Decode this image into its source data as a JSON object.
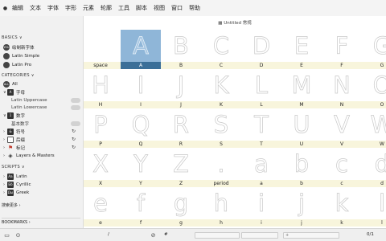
{
  "menubar": {
    "items": [
      "编辑",
      "文本",
      "字体",
      "字形",
      "元素",
      "轮廓",
      "工具",
      "脚本",
      "视图",
      "窗口",
      "帮助"
    ]
  },
  "sidebar": {
    "basics_header": "BASICS",
    "fonts": [
      {
        "badge": "YOU",
        "label": "绘制新字体"
      },
      {
        "badge": "",
        "label": "Latin Simple"
      },
      {
        "badge": "",
        "label": "Latin Pro"
      }
    ],
    "categories_header": "CATEGORIES",
    "all": {
      "badge": "ALL",
      "label": "All"
    },
    "letter": {
      "label": "字母"
    },
    "latin_upper": "Latin Uppercase",
    "latin_lower": "Latin Lowercase",
    "number": {
      "label": "数字"
    },
    "basic_number": "基本数字",
    "symbols": {
      "label": "符号"
    },
    "suffix": {
      "label": "后缀"
    },
    "mark": {
      "label": "标记"
    },
    "layers": {
      "label": "Layers & Masters"
    },
    "scripts_header": "SCRIPTS",
    "scripts": [
      {
        "badge": "Aa",
        "label": "Latin"
      },
      {
        "badge": "Бб",
        "label": "Cyrillic"
      },
      {
        "badge": "Ωω",
        "label": "Greek"
      }
    ],
    "search_more": "搜索更多",
    "bookmarks": "BOOKMARKS"
  },
  "document": {
    "title": "Untitled 常规"
  },
  "grid": {
    "rows": [
      [
        {
          "g": "A",
          "l": "space",
          "sel": false,
          "hide": true
        },
        {
          "g": "A",
          "l": "A",
          "sel": true
        },
        {
          "g": "B",
          "l": "B"
        },
        {
          "g": "C",
          "l": "C"
        },
        {
          "g": "D",
          "l": "D"
        },
        {
          "g": "E",
          "l": "E"
        },
        {
          "g": "F",
          "l": "F"
        },
        {
          "g": "G",
          "l": "G"
        }
      ],
      [
        {
          "g": "H",
          "l": "H"
        },
        {
          "g": "I",
          "l": "I"
        },
        {
          "g": "J",
          "l": "J"
        },
        {
          "g": "K",
          "l": "K"
        },
        {
          "g": "L",
          "l": "L"
        },
        {
          "g": "M",
          "l": "M"
        },
        {
          "g": "N",
          "l": "N"
        },
        {
          "g": "O",
          "l": "O"
        }
      ],
      [
        {
          "g": "P",
          "l": "P"
        },
        {
          "g": "Q",
          "l": "Q"
        },
        {
          "g": "R",
          "l": "R"
        },
        {
          "g": "S",
          "l": "S"
        },
        {
          "g": "T",
          "l": "T"
        },
        {
          "g": "U",
          "l": "U"
        },
        {
          "g": "V",
          "l": "V"
        },
        {
          "g": "W",
          "l": "W"
        }
      ],
      [
        {
          "g": "X",
          "l": "X"
        },
        {
          "g": "Y",
          "l": "Y"
        },
        {
          "g": "Z",
          "l": "Z"
        },
        {
          "g": ".",
          "l": "period"
        },
        {
          "g": "a",
          "l": "a"
        },
        {
          "g": "b",
          "l": "b"
        },
        {
          "g": "c",
          "l": "c"
        },
        {
          "g": "d",
          "l": "d"
        }
      ],
      [
        {
          "g": "e",
          "l": "e"
        },
        {
          "g": "f",
          "l": "f"
        },
        {
          "g": "g",
          "l": "g"
        },
        {
          "g": "h",
          "l": "h"
        },
        {
          "g": "i",
          "l": "i"
        },
        {
          "g": "j",
          "l": "j"
        },
        {
          "g": "k",
          "l": "k"
        },
        {
          "g": "l",
          "l": "l"
        }
      ]
    ]
  },
  "status": {
    "slash": "/",
    "hash": "#",
    "count": "0/1"
  }
}
